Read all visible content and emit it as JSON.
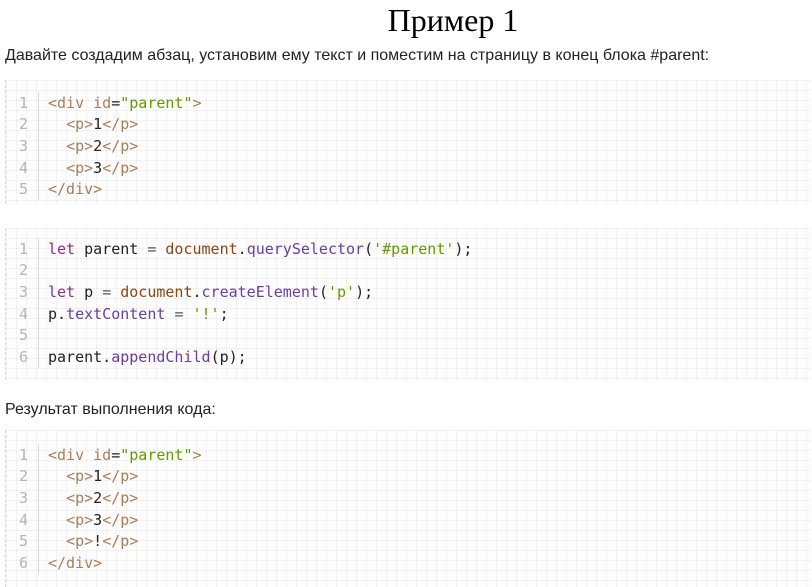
{
  "page": {
    "title": "Пример 1",
    "intro": "Давайте создадим абзац, установим ему текст и поместим на страницу в конец блока #parent:",
    "result_label": "Результат выполнения кода:"
  },
  "html_code": [
    {
      "n": "1",
      "text": "<div id=\"parent\">"
    },
    {
      "n": "2",
      "text": "  <p>1</p>"
    },
    {
      "n": "3",
      "text": "  <p>2</p>"
    },
    {
      "n": "4",
      "text": "  <p>3</p>"
    },
    {
      "n": "5",
      "text": "</div>"
    }
  ],
  "js_code": [
    {
      "n": "1",
      "text": "let parent = document.querySelector('#parent');"
    },
    {
      "n": "2",
      "text": ""
    },
    {
      "n": "3",
      "text": "let p = document.createElement('p');"
    },
    {
      "n": "4",
      "text": "p.textContent = '!';"
    },
    {
      "n": "5",
      "text": ""
    },
    {
      "n": "6",
      "text": "parent.appendChild(p);"
    }
  ],
  "result_code": [
    {
      "n": "1",
      "text": "<div id=\"parent\">"
    },
    {
      "n": "2",
      "text": "  <p>1</p>"
    },
    {
      "n": "3",
      "text": "  <p>2</p>"
    },
    {
      "n": "4",
      "text": "  <p>3</p>"
    },
    {
      "n": "5",
      "text": "  <p>!</p>"
    },
    {
      "n": "6",
      "text": "</div>"
    }
  ],
  "colors": {
    "tag": "#a67f59",
    "string": "#669900",
    "keyword": "#8b2e8b",
    "function": "#6a3e9c",
    "line_number": "#b5b5b5"
  }
}
